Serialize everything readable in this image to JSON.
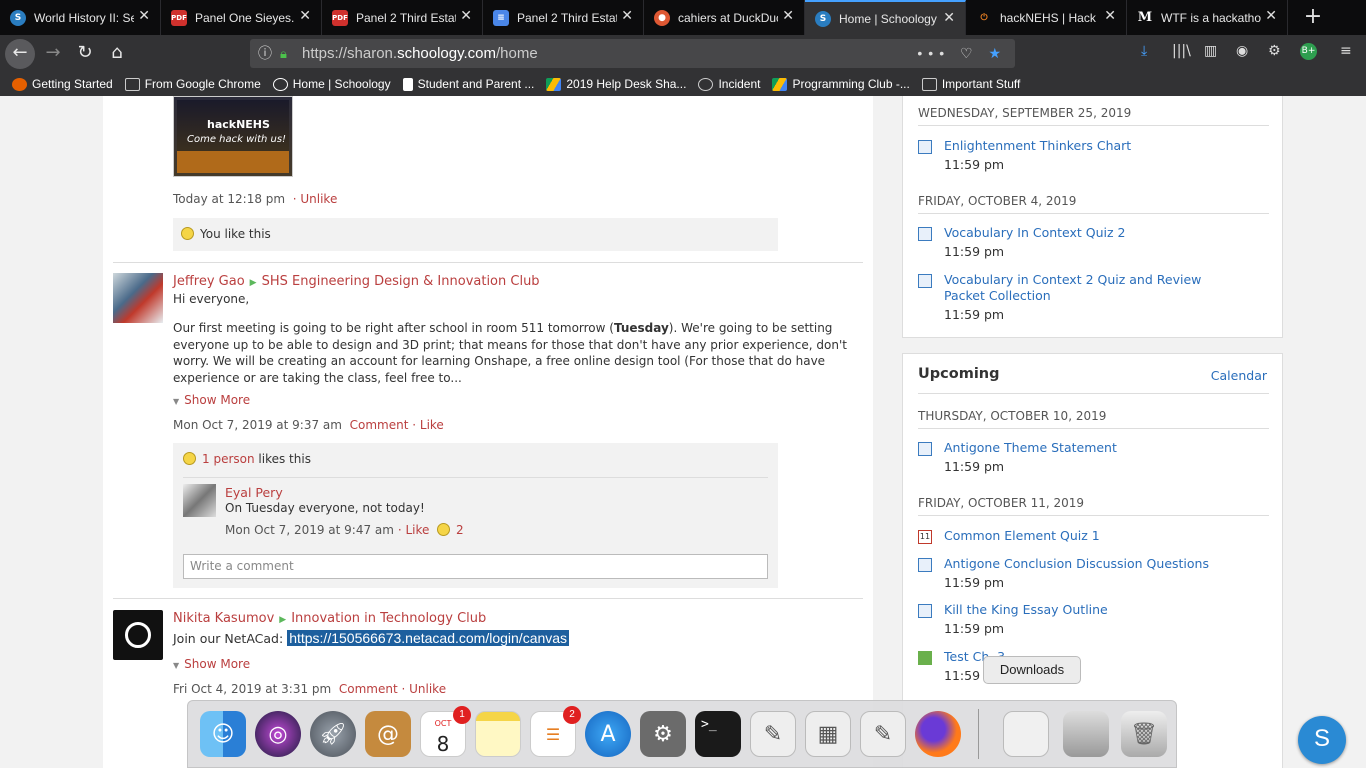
{
  "browser": {
    "tabs": [
      {
        "title": "World History II: Se",
        "icon": "schoology-icon",
        "fav": "S",
        "color": "#1d1d1d"
      },
      {
        "title": "Panel One Sieyes.p",
        "icon": "pdf-icon",
        "fav": "PDF",
        "color": "#d0312d"
      },
      {
        "title": "Panel 2 Third Estat",
        "icon": "pdf-icon",
        "fav": "PDF",
        "color": "#d0312d"
      },
      {
        "title": "Panel 2 Third Estat",
        "icon": "google-docs-icon",
        "fav": "≡",
        "color": "#4a86e8"
      },
      {
        "title": "cahiers at DuckDuc",
        "icon": "duckduckgo-icon",
        "fav": "●",
        "color": "#de5833"
      },
      {
        "title": "Home | Schoology",
        "icon": "schoology-icon",
        "fav": "S",
        "color": "#1d1d1d",
        "active": true
      },
      {
        "title": "hackNEHS | Hack N",
        "icon": "power-icon",
        "fav": "⏻",
        "color": "#e67e22"
      },
      {
        "title": "WTF is a hackathon",
        "icon": "medium-icon",
        "fav": "M",
        "color": "#ffffff"
      }
    ],
    "new_tab": "+",
    "url_prefix": "https://sharon.",
    "url_domain": "schoology.com",
    "url_suffix": "/home",
    "url_right_icons": "••• ♡ ★",
    "bookmarks": [
      {
        "label": "Getting Started",
        "icon": "firefox-icon",
        "color": "#e66000"
      },
      {
        "label": "From Google Chrome",
        "icon": "folder-icon",
        "color": "#999999"
      },
      {
        "label": "Home | Schoology",
        "icon": "schoology-icon",
        "color": "#ffffff"
      },
      {
        "label": "Student and Parent ...",
        "icon": "powerschool-icon",
        "color": "#ffffff"
      },
      {
        "label": "2019 Help Desk Sha...",
        "icon": "google-drive-icon",
        "color": "#fbbc05"
      },
      {
        "label": "Incident",
        "icon": "globe-icon",
        "color": "#cccccc"
      },
      {
        "label": "Programming Club -...",
        "icon": "google-drive-icon",
        "color": "#fbbc05"
      },
      {
        "label": "Important Stuff",
        "icon": "folder-icon",
        "color": "#999999"
      }
    ]
  },
  "feed": {
    "post0": {
      "photo_title": "hackNEHS",
      "photo_caption": "Come hack with us!",
      "time": "Today at 12:18 pm",
      "unlike": "· Unlike",
      "likes": "You like this"
    },
    "post1": {
      "author": "Jeffrey Gao",
      "group": "SHS Engineering Design & Innovation Club",
      "greeting": "Hi everyone,",
      "body_start": "Our first meeting is going to be right after school in room 511 tomorrow (",
      "body_bold": "Tuesday",
      "body_end": "). We're going to be setting everyone up to be able to design and 3D print; that means for those that don't have any prior experience, don't worry. We will be creating an account for learning Onshape, a free online design tool (For those that do have experience or are taking the class, feel free to...",
      "show_more": "Show More",
      "time": "Mon Oct 7, 2019 at 9:37 am",
      "comment": "Comment",
      "like": "· Like",
      "likes_link": "1 person",
      "likes_text": "likes this",
      "reply_author": "Eyal Pery",
      "reply_text": "On Tuesday everyone, not today!",
      "reply_time": "Mon Oct 7, 2019 at 9:47 am",
      "reply_like": "· Like",
      "reply_like_count": "2",
      "comment_placeholder": "Write a comment"
    },
    "post2": {
      "author": "Nikita Kasumov",
      "group": "Innovation in Technology Club",
      "body": "Join our NetACad:",
      "link": "https://150566673.netacad.com/login/canvas",
      "show_more": "Show More",
      "time": "Fri Oct 4, 2019 at 3:31 pm",
      "comment": "Comment",
      "unlike": "· Unlike"
    }
  },
  "overdue": {
    "date1": "WEDNESDAY, SEPTEMBER 25, 2019",
    "item1": {
      "name": "Enlightenment Thinkers Chart",
      "time": "11:59 pm"
    },
    "date2": "FRIDAY, OCTOBER 4, 2019",
    "item2": {
      "name": "Vocabulary In Context Quiz 2",
      "time": "11:59 pm"
    },
    "item3": {
      "name": "Vocabulary in Context 2 Quiz and Review Packet Collection",
      "time": "11:59 pm"
    }
  },
  "upcoming": {
    "title": "Upcoming",
    "calendar_link": "Calendar",
    "date1": "THURSDAY, OCTOBER 10, 2019",
    "item1": {
      "name": "Antigone Theme Statement",
      "time": "11:59 pm"
    },
    "date2": "FRIDAY, OCTOBER 11, 2019",
    "item2": {
      "name": "Common Element Quiz 1",
      "icon_day": "11"
    },
    "item3": {
      "name": "Antigone Conclusion Discussion Questions",
      "time": "11:59 pm"
    },
    "item4": {
      "name": "Kill the King Essay Outline",
      "time": "11:59 pm"
    },
    "item5": {
      "name": "Test Ch. 3",
      "time": "11:59 pm"
    }
  },
  "dock": {
    "tooltip": "Downloads",
    "calendar_month": "OCT",
    "calendar_day": "8",
    "calendar_badge": "1",
    "reminders_badge": "2",
    "terminal_text": ">_"
  },
  "fab": "S"
}
